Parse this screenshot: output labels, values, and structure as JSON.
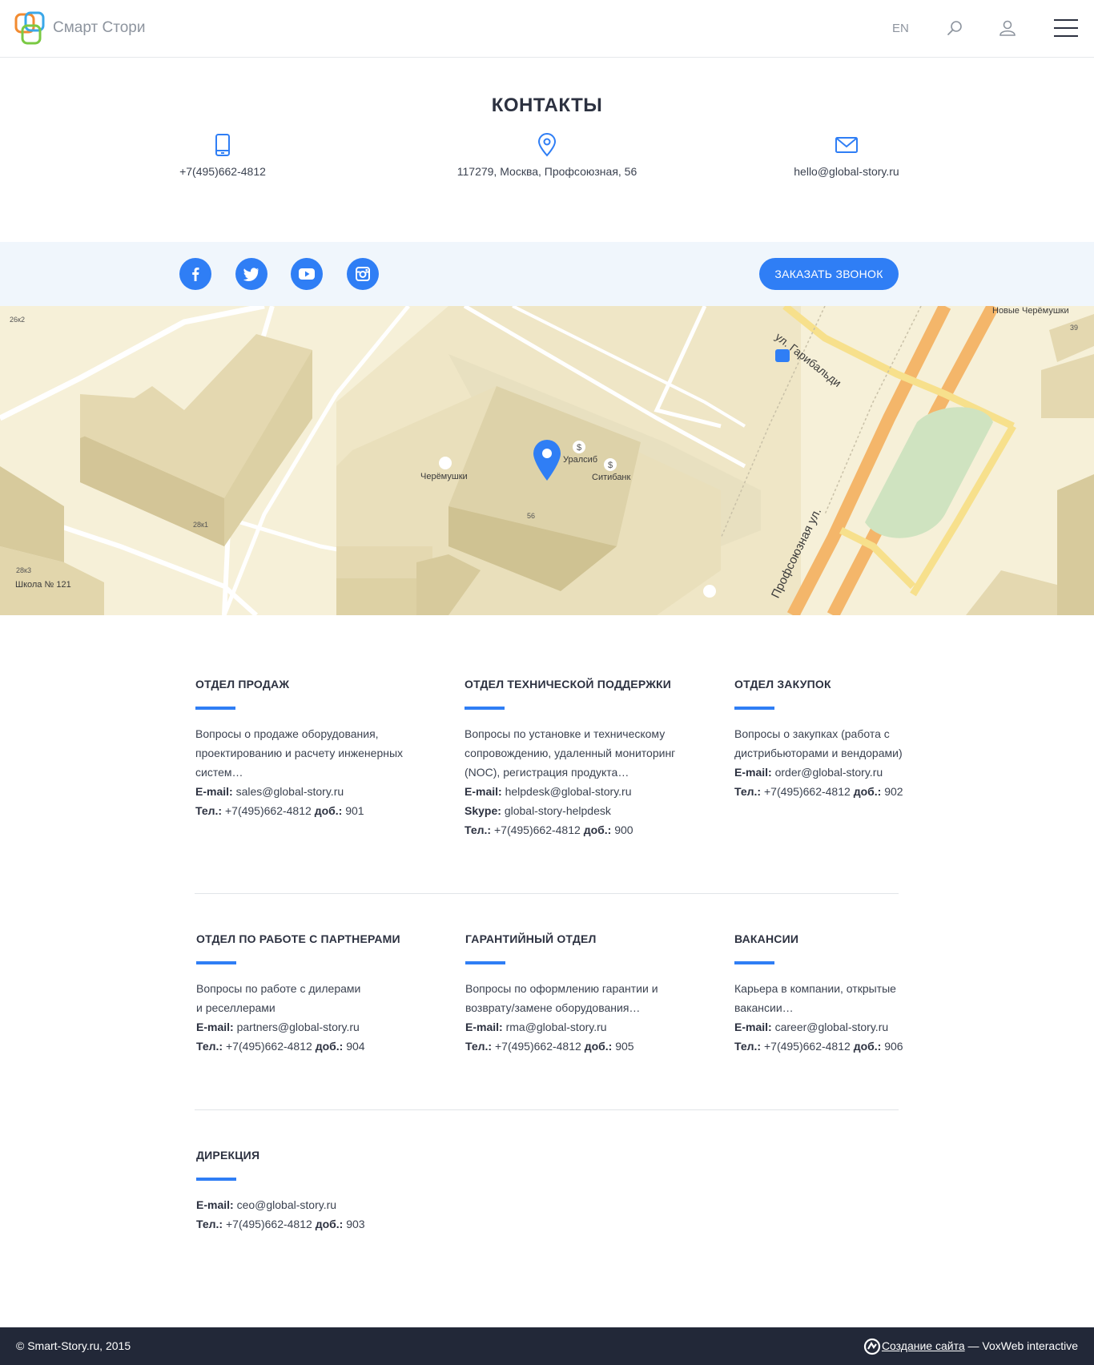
{
  "header": {
    "brand": "Смарт Стори",
    "lang": "EN",
    "icons": {
      "search": "search-icon",
      "user": "user-icon",
      "menu": "menu-icon"
    }
  },
  "contacts": {
    "title": "КОНТАКТЫ",
    "phone": "+7(495)662-4812",
    "address": "117279, Москва, Профсоюзная, 56",
    "email": "hello@global-story.ru"
  },
  "social": {
    "networks": [
      "facebook-icon",
      "twitter-icon",
      "youtube-icon",
      "instagram-icon"
    ],
    "call_button": "ЗАКАЗАТЬ ЗВОНОК"
  },
  "map": {
    "labels": {
      "new_cheryomushki": "Новые Черёмушки",
      "garibaldi": "ул. Гарибальди",
      "profsoyuznaya": "Профсоюзная ул.",
      "cheryomushki": "Черёмушки",
      "uralsib": "Уралсиб",
      "citibank": "Ситибанк",
      "house_56": "56",
      "house_28k1": "28к1",
      "house_28k3": "28к3",
      "house_26k2": "26к2",
      "house_39": "39",
      "school": "Школа № 121"
    }
  },
  "departments": [
    {
      "title": "ОТДЕЛ ПРОДАЖ",
      "description": "Вопросы о продаже оборудования, проектированию и расчету инженерных систем…",
      "email_label": "E-mail:",
      "email": "sales@global-story.ru",
      "tel_label": "Тел.:",
      "tel": "+7(495)662-4812",
      "ext_label": "доб.:",
      "ext": "901"
    },
    {
      "title": "ОТДЕЛ ТЕХНИЧЕСКОЙ ПОДДЕРЖКИ",
      "description": "Вопросы по установке и техническому сопровождению, удаленный мониторинг (NOC), регистрация продукта…",
      "email_label": "E-mail:",
      "email": "helpdesk@global-story.ru",
      "skype_label": "Skype:",
      "skype": "global-story-helpdesk",
      "tel_label": "Тел.:",
      "tel": "+7(495)662-4812",
      "ext_label": "доб.:",
      "ext": "900"
    },
    {
      "title": "ОТДЕЛ ЗАКУПОК",
      "description": "Вопросы о закупках (работа с дистрибьюторами и вендорами)",
      "email_label": "E-mail:",
      "email": "order@global-story.ru",
      "tel_label": "Тел.:",
      "tel": "+7(495)662-4812",
      "ext_label": "доб.:",
      "ext": "902"
    },
    {
      "title": "ОТДЕЛ ПО РАБОТЕ С ПАРТНЕРАМИ",
      "description": "Вопросы по работе с дилерами и реселлерами",
      "email_label": "E-mail:",
      "email": "partners@global-story.ru",
      "tel_label": "Тел.:",
      "tel": "+7(495)662-4812",
      "ext_label": "доб.:",
      "ext": "904"
    },
    {
      "title": "ГАРАНТИЙНЫЙ ОТДЕЛ",
      "description": "Вопросы по оформлению гарантии и возврату/замене оборудования…",
      "email_label": "E-mail:",
      "email": "rma@global-story.ru",
      "tel_label": "Тел.:",
      "tel": "+7(495)662-4812",
      "ext_label": "доб.:",
      "ext": "905"
    },
    {
      "title": "ВАКАНСИИ",
      "description": "Карьера в компании, открытые вакансии…",
      "email_label": "E-mail:",
      "email": "career@global-story.ru",
      "tel_label": "Тел.:",
      "tel": "+7(495)662-4812",
      "ext_label": "доб.:",
      "ext": "906"
    },
    {
      "title": "ДИРЕКЦИЯ",
      "email_label": "E-mail:",
      "email": "ceo@global-story.ru",
      "tel_label": "Тел.:",
      "tel": "+7(495)662-4812",
      "ext_label": "доб.:",
      "ext": "903"
    }
  ],
  "footer": {
    "copyright": "© Smart-Story.ru, 2015",
    "credit_link": "Создание сайта",
    "credit_rest": " — VoxWeb interactive"
  },
  "colors": {
    "accent": "#2f7ef5",
    "footer_bg": "#222838",
    "social_bg": "#f0f6fc"
  }
}
